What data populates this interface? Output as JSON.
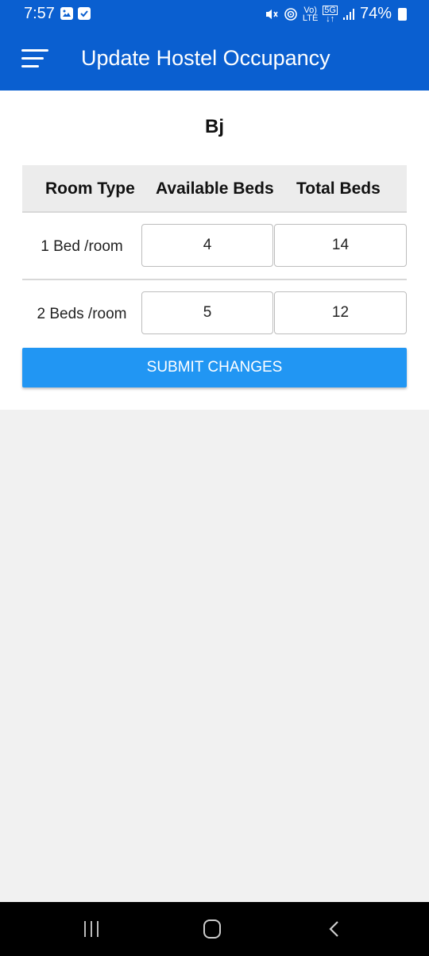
{
  "status_bar": {
    "time": "7:57",
    "battery": "74%",
    "network_top": "Vo)",
    "network_bottom": "LTE",
    "net_5g": "5G"
  },
  "app_bar": {
    "title": "Update Hostel Occupancy",
    "menu_icon": "hamburger-menu-icon",
    "color": "#0a5fd0"
  },
  "hostel": {
    "name": "Bj"
  },
  "table": {
    "headers": [
      "Room Type",
      "Available Beds",
      "Total Beds"
    ],
    "rows": [
      {
        "room_type": "1 Bed /room",
        "available": "4",
        "total": "14"
      },
      {
        "room_type": "2 Beds /room",
        "available": "5",
        "total": "12"
      }
    ]
  },
  "submit": {
    "label": "SUBMIT CHANGES",
    "color": "#2196f3"
  }
}
